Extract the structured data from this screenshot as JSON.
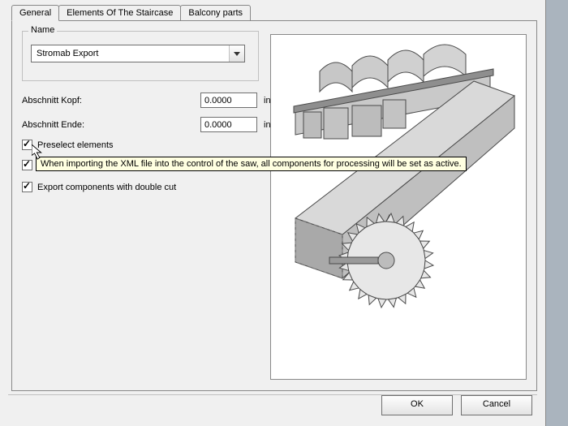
{
  "tabs": {
    "general": "General",
    "elements": "Elements Of The Staircase",
    "balcony": "Balcony parts"
  },
  "name_group": {
    "title": "Name",
    "combo_value": "Stromab Export"
  },
  "fields": {
    "kopf_label": "Abschnitt Kopf:",
    "kopf_value": "0.0000",
    "kopf_unit": "in",
    "ende_label": "Abschnitt Ende:",
    "ende_value": "0.0000",
    "ende_unit": "in"
  },
  "checks": {
    "preselect_label": "Preselect elements",
    "double_cut_label": "Export components with double cut"
  },
  "tooltip": "When importing the XML file into the control of the saw, all components for processing will be set as active.",
  "buttons": {
    "ok": "OK",
    "cancel": "Cancel"
  }
}
